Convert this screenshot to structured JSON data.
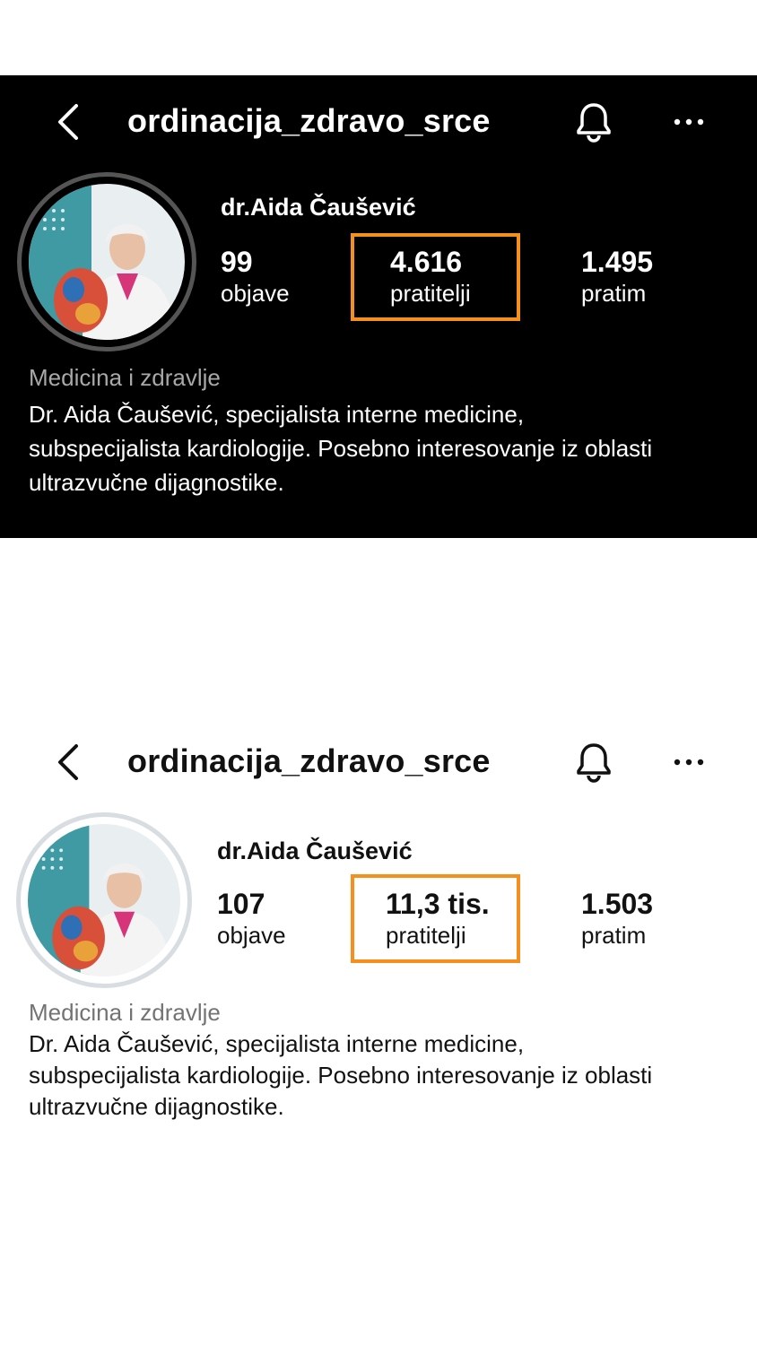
{
  "top_profile": {
    "username": "ordinacija_zdravo_srce",
    "display_name": "dr.Aida Čaušević",
    "stats": [
      {
        "value": "99",
        "label": "objave"
      },
      {
        "value": "4.616",
        "label": "pratitelji"
      },
      {
        "value": "1.495",
        "label": "pratim"
      }
    ],
    "category": "Medicina i zdravlje",
    "bio_lines": [
      "Dr. Aida Čaušević, specijalista interne medicine,",
      "subspecijalista kardiologije. Posebno interesovanje iz oblasti",
      "ultrazvučne dijagnostike."
    ]
  },
  "bottom_profile": {
    "username": "ordinacija_zdravo_srce",
    "display_name": "dr.Aida Čaušević",
    "stats": [
      {
        "value": "107",
        "label": "objave"
      },
      {
        "value": "11,3 tis.",
        "label": "pratitelji"
      },
      {
        "value": "1.503",
        "label": "pratim"
      }
    ],
    "category": "Medicina i zdravlje",
    "bio_lines": [
      "Dr. Aida Čaušević, specijalista interne medicine,",
      "subspecijalista kardiologije. Posebno interesovanje iz oblasti",
      "ultrazvučne dijagnostike."
    ]
  },
  "icons": {
    "back": "chevron-left-icon",
    "notifications": "bell-icon",
    "more": "more-horizontal-icon"
  },
  "colors": {
    "highlight": "#f5901e",
    "dark_background": "#000000",
    "light_background": "#ffffff",
    "category_dark": "#a8a8a8",
    "category_light": "#737373"
  }
}
